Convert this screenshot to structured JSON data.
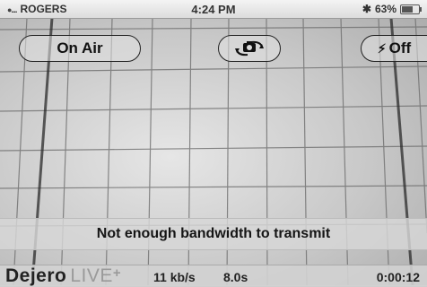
{
  "status_bar": {
    "signal": "●....",
    "carrier": "ROGERS",
    "time": "4:24 PM",
    "bluetooth_icon": "bluetooth-icon",
    "battery_text": "63%",
    "battery_level": 0.63
  },
  "controls": {
    "on_air_label": "On Air",
    "camera_switch_icon": "camera-switch-icon",
    "flash_label": "Off",
    "flash_icon": "lightning-bolt-icon"
  },
  "message": "Not enough bandwidth to transmit",
  "bottom_bar": {
    "brand_name": "Dejero",
    "brand_product": "LIVE",
    "brand_plus": "+",
    "bitrate": "11 kb/s",
    "delay": "8.0s",
    "elapsed": "0:00:12"
  }
}
